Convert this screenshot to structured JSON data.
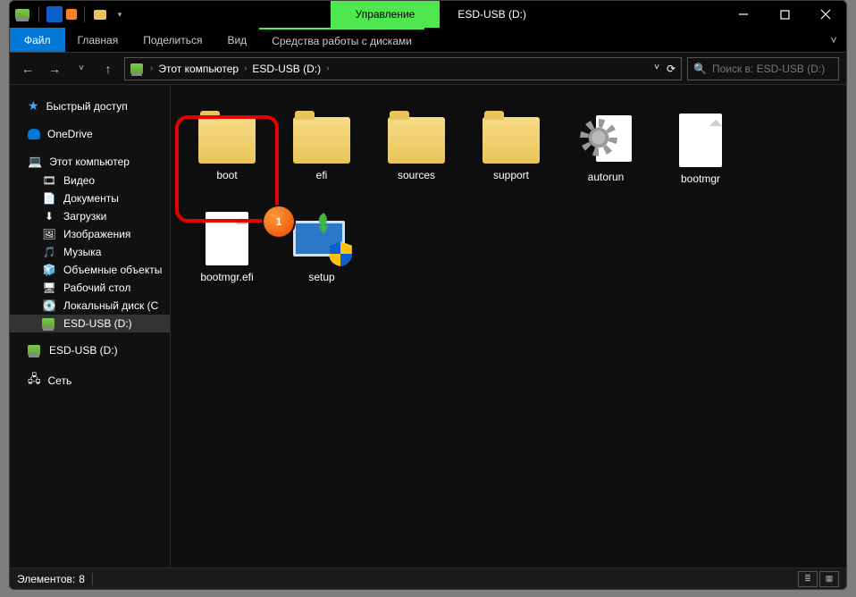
{
  "window": {
    "title": "ESD-USB (D:)",
    "context_tab": "Управление"
  },
  "win_controls": {
    "min": "—",
    "max": "☐",
    "close": "✕"
  },
  "ribbon": {
    "file": "Файл",
    "tabs": [
      "Главная",
      "Поделиться",
      "Вид"
    ],
    "context_tab": "Средства работы с дисками",
    "expand": "˅"
  },
  "nav": {
    "back": "←",
    "fwd": "→",
    "recent": "˅",
    "up": "↑"
  },
  "address": {
    "root": "Этот компьютер",
    "current": "ESD-USB (D:)",
    "sep": "›",
    "refresh": "⟳"
  },
  "search": {
    "icon": "🔍",
    "placeholder": "Поиск в: ESD-USB (D:)"
  },
  "sidebar": {
    "quick_access": "Быстрый доступ",
    "onedrive": "OneDrive",
    "this_pc": "Этот компьютер",
    "items": [
      {
        "icon": "🎞",
        "label": "Видео"
      },
      {
        "icon": "📄",
        "label": "Документы"
      },
      {
        "icon": "⬇",
        "label": "Загрузки"
      },
      {
        "icon": "🖼",
        "label": "Изображения"
      },
      {
        "icon": "🎵",
        "label": "Музыка"
      },
      {
        "icon": "🧊",
        "label": "Объемные объекты"
      },
      {
        "icon": "🖥",
        "label": "Рабочий стол"
      },
      {
        "icon": "💽",
        "label": "Локальный диск (C"
      }
    ],
    "esd_usb": "ESD-USB (D:)",
    "esd_usb2": "ESD-USB (D:)",
    "network": "Сеть"
  },
  "items": [
    {
      "type": "folder",
      "label": "boot"
    },
    {
      "type": "folder",
      "label": "efi"
    },
    {
      "type": "folder",
      "label": "sources"
    },
    {
      "type": "folder",
      "label": "support"
    },
    {
      "type": "inf",
      "label": "autorun"
    },
    {
      "type": "file",
      "label": "bootmgr"
    },
    {
      "type": "file",
      "label": "bootmgr.efi"
    },
    {
      "type": "setup",
      "label": "setup"
    }
  ],
  "status": {
    "count_label": "Элементов:",
    "count": "8"
  },
  "marker": "1"
}
